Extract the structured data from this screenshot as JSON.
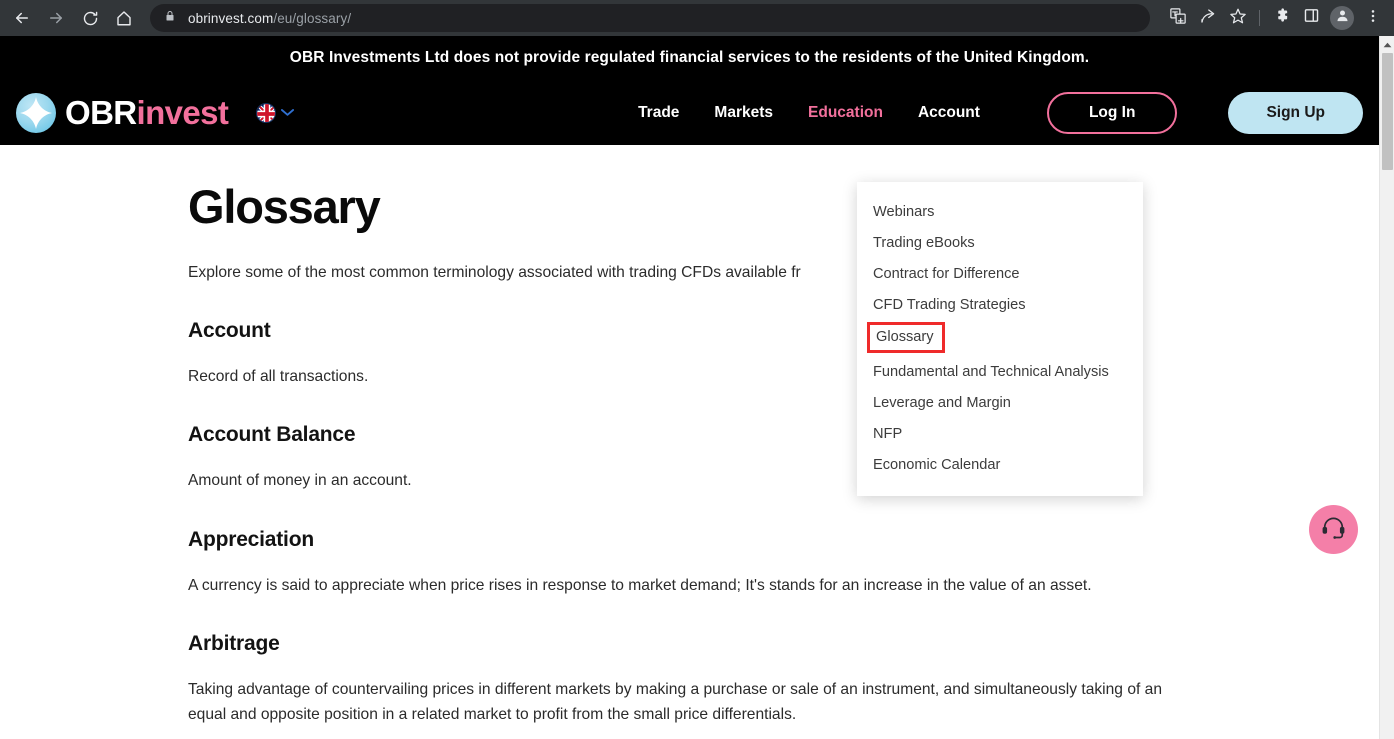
{
  "browser": {
    "back_icon": "arrow-left-icon",
    "forward_icon": "arrow-right-icon",
    "reload_icon": "reload-icon",
    "home_icon": "home-icon",
    "lock_icon": "lock-icon",
    "url_domain": "obrinvest.com",
    "url_path": "/eu/glossary/",
    "url_full": "obrinvest.com/eu/glossary/",
    "actions": [
      {
        "name": "translate-icon",
        "label": "Translate"
      },
      {
        "name": "share-icon",
        "label": "Share"
      },
      {
        "name": "bookmark-star-icon",
        "label": "Bookmark"
      },
      {
        "name": "extensions-puzzle-icon",
        "label": "Extensions"
      },
      {
        "name": "side-panel-icon",
        "label": "Side panel"
      },
      {
        "name": "profile-avatar-icon",
        "label": "Profile"
      },
      {
        "name": "chrome-menu-icon",
        "label": "Customize and control"
      }
    ]
  },
  "site": {
    "banner_text": "OBR Investments Ltd does not provide regulated financial services to the residents of the United Kingdom.",
    "logo": {
      "primary": "OBR",
      "secondary": "invest",
      "mark_icon": "four-point-star-icon"
    },
    "language": {
      "flag_icon": "uk-flag-icon",
      "chevron_icon": "chevron-down-icon"
    },
    "nav": [
      {
        "label": "Trade",
        "active": false
      },
      {
        "label": "Markets",
        "active": false
      },
      {
        "label": "Education",
        "active": true
      },
      {
        "label": "Account",
        "active": false
      }
    ],
    "login_label": "Log In",
    "signup_label": "Sign Up",
    "colors": {
      "header_bg": "#000000",
      "accent_pink": "#f2709c",
      "accent_blue": "#bfe5f2",
      "highlight_red": "#ef2a2a",
      "support_pink": "#f47fa8"
    }
  },
  "dropdown": {
    "items": [
      {
        "label": "Webinars",
        "highlighted": false
      },
      {
        "label": "Trading eBooks",
        "highlighted": false
      },
      {
        "label": "Contract for Difference",
        "highlighted": false
      },
      {
        "label": "CFD Trading Strategies",
        "highlighted": false
      },
      {
        "label": "Glossary",
        "highlighted": true
      },
      {
        "label": "Fundamental and Technical Analysis",
        "highlighted": false
      },
      {
        "label": "Leverage and Margin",
        "highlighted": false
      },
      {
        "label": "NFP",
        "highlighted": false
      },
      {
        "label": "Economic Calendar",
        "highlighted": false
      }
    ]
  },
  "content": {
    "title": "Glossary",
    "intro": "Explore some of the most common terminology associated with trading CFDs available fr",
    "terms": [
      {
        "term": "Account",
        "definition": "Record of all transactions."
      },
      {
        "term": "Account Balance",
        "definition": "Amount of money in an account."
      },
      {
        "term": "Appreciation",
        "definition": "A currency is said to appreciate when price rises in response to market demand; It's stands for an increase in the value of an asset."
      },
      {
        "term": "Arbitrage",
        "definition": "Taking advantage of countervailing prices in different markets by making a purchase or sale of an instrument, and simultaneously taking of an equal and opposite position in a related market to profit from the small price differentials."
      }
    ]
  },
  "support": {
    "icon": "headset-icon",
    "label": "Support chat"
  },
  "scrollbar": {
    "up_arrow_icon": "triangle-up-icon"
  }
}
